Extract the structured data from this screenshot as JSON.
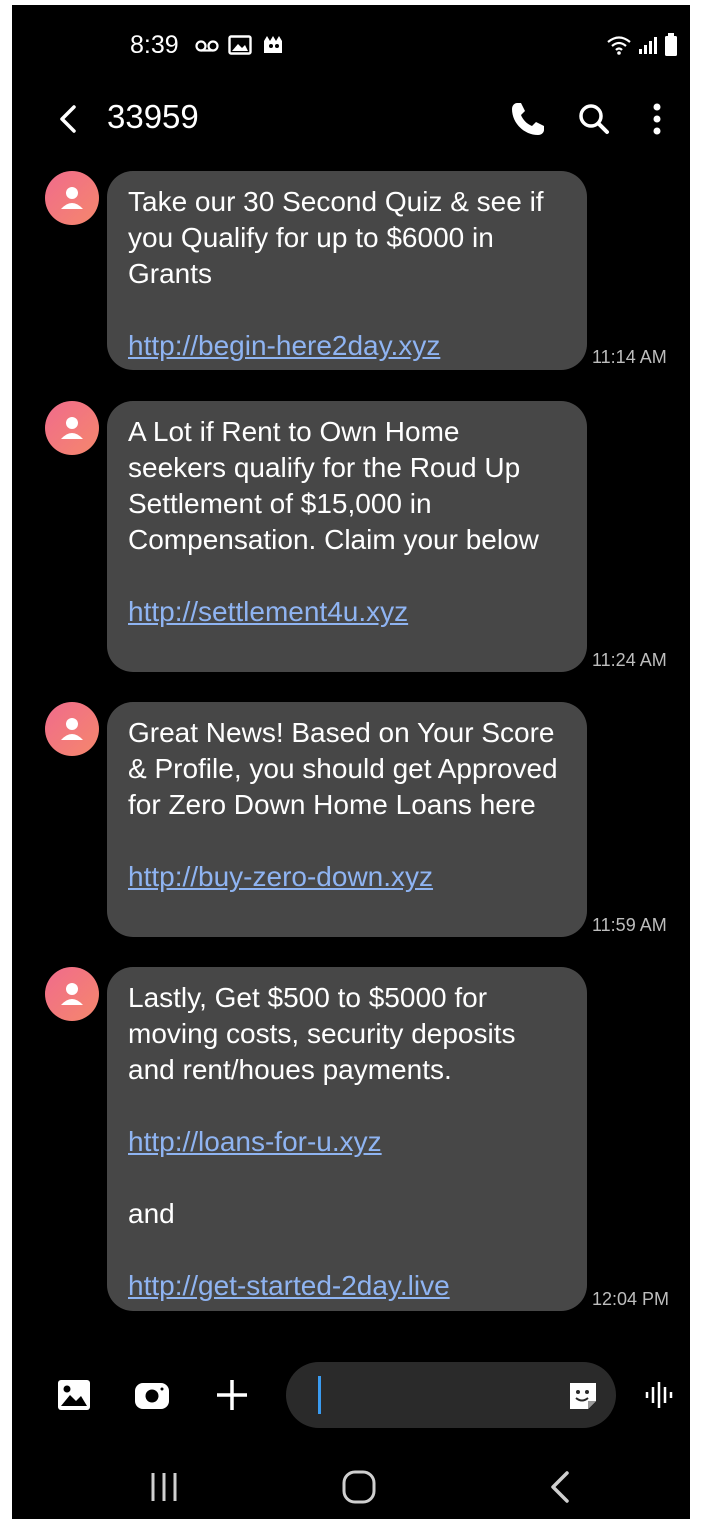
{
  "status_bar": {
    "time": "8:39",
    "left_icons": [
      "voicemail-icon",
      "gallery-icon",
      "game-notification-icon"
    ],
    "right_icons": [
      "wifi-icon",
      "signal-icon",
      "battery-icon"
    ]
  },
  "header": {
    "title": "33959",
    "actions": [
      "call-icon",
      "search-icon",
      "more-options-icon"
    ]
  },
  "colors": {
    "background": "#000000",
    "bubble": "#474747",
    "link": "#8fb4f2",
    "avatar_gradient": [
      "#f06b8c",
      "#f5876c"
    ],
    "cursor": "#3a9bf0"
  },
  "messages": [
    {
      "paragraphs": [
        "Take our 30 Second Quiz & see if you Qualify for up to $6000 in Grants"
      ],
      "links": [
        "http://begin-here2day.xyz"
      ],
      "time": "11:14 AM"
    },
    {
      "paragraphs": [
        "A Lot if Rent to Own Home seekers qualify for the Roud Up Settlement of $15,000 in Compensation. Claim your below"
      ],
      "links": [
        "http://settlement4u.xyz"
      ],
      "time": "11:24 AM"
    },
    {
      "paragraphs": [
        "Great News! Based on Your Score & Profile, you should get Approved for Zero Down Home Loans here"
      ],
      "links": [
        "http://buy-zero-down.xyz"
      ],
      "time": "11:59 AM"
    },
    {
      "paragraphs": [
        "Lastly, Get $500 to $5000 for moving costs, security deposits and rent/houes payments."
      ],
      "links": [
        "http://loans-for-u.xyz",
        "http://get-started-2day.live"
      ],
      "connector": "and",
      "time": "12:04 PM"
    }
  ],
  "composer": {
    "input_value": "",
    "icons": [
      "gallery-icon",
      "camera-icon",
      "add-icon",
      "sticker-icon",
      "voice-icon"
    ]
  },
  "nav_bar": {
    "buttons": [
      "recents-icon",
      "home-icon",
      "back-icon"
    ]
  }
}
